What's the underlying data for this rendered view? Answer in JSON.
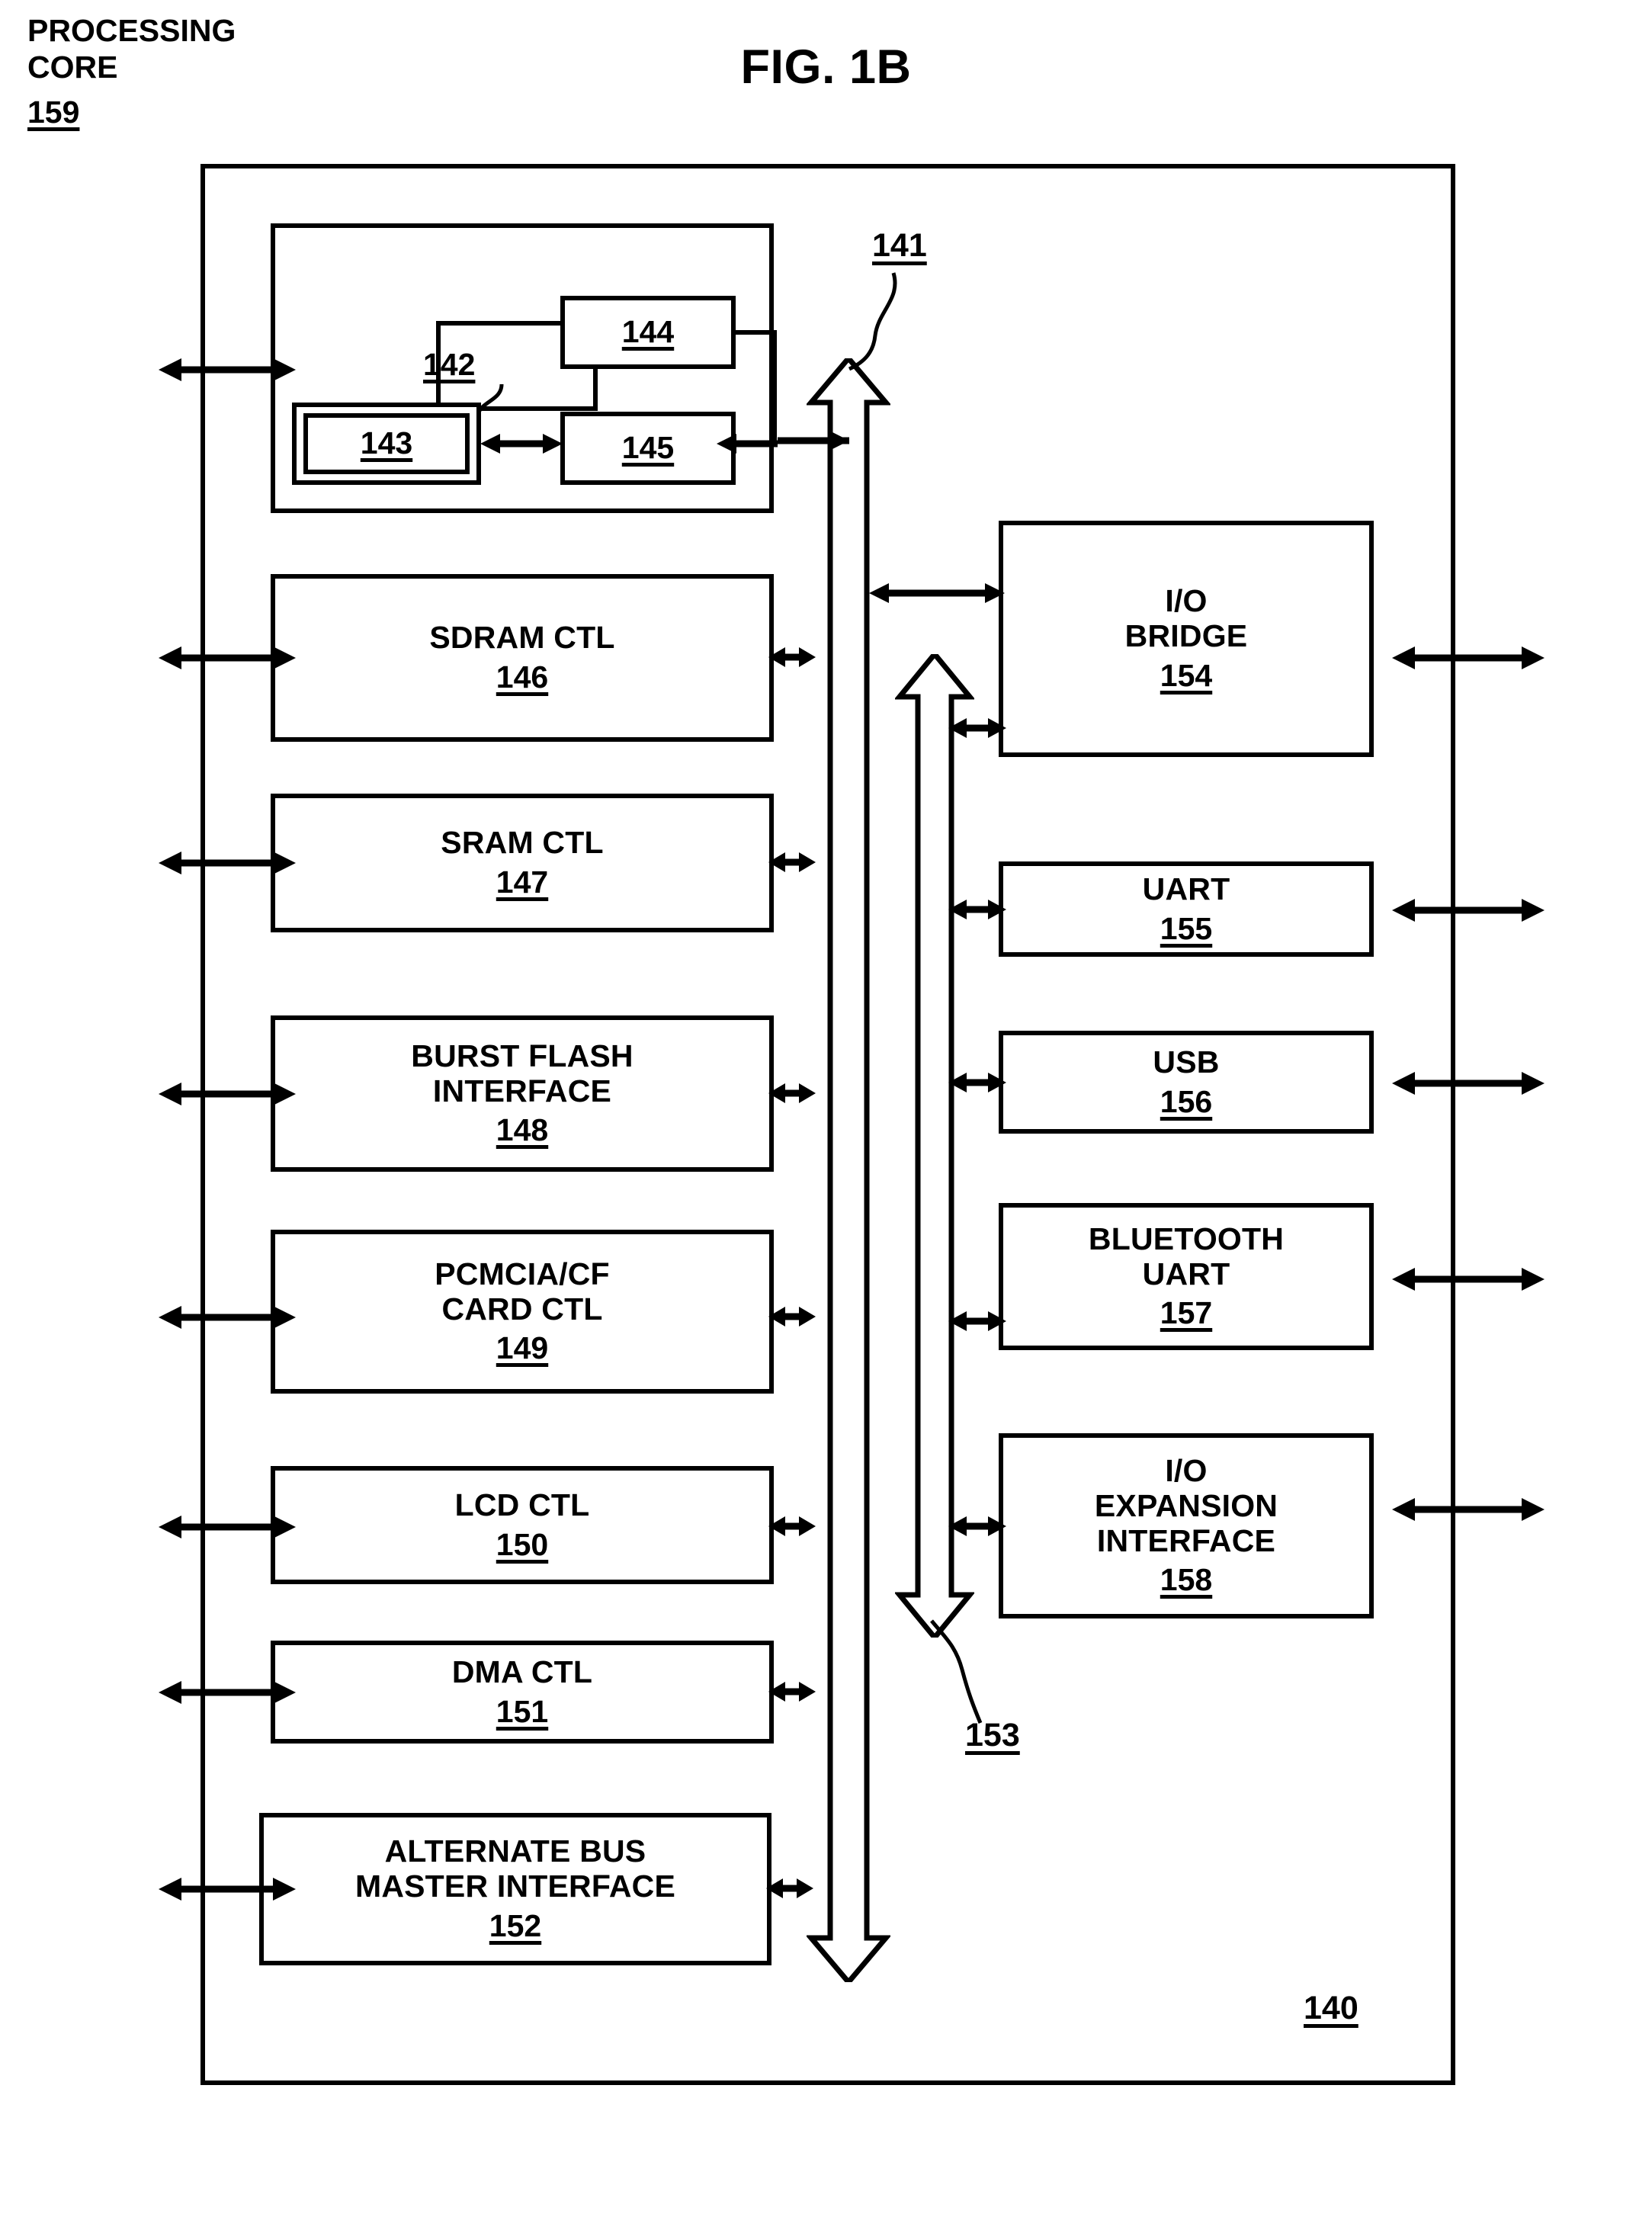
{
  "figure": {
    "title": "FIG. 1B",
    "chip_label": "140"
  },
  "processing_core": {
    "title": "PROCESSING\nCORE",
    "number": "159",
    "inner_blocks": [
      {
        "name": "block-142",
        "number": "142"
      },
      {
        "name": "block-143",
        "number": "143"
      },
      {
        "name": "block-144",
        "number": "144"
      },
      {
        "name": "block-145",
        "number": "145"
      }
    ]
  },
  "buses": [
    {
      "name": "main-bus",
      "number": "141"
    },
    {
      "name": "io-bus",
      "number": "153"
    }
  ],
  "left_column": [
    {
      "title": "SDRAM CTL",
      "number": "146"
    },
    {
      "title": "SRAM CTL",
      "number": "147"
    },
    {
      "title": "BURST FLASH\nINTERFACE",
      "number": "148"
    },
    {
      "title": "PCMCIA/CF\nCARD CTL",
      "number": "149"
    },
    {
      "title": "LCD CTL",
      "number": "150"
    },
    {
      "title": "DMA CTL",
      "number": "151"
    },
    {
      "title": "ALTERNATE BUS\nMASTER INTERFACE",
      "number": "152"
    }
  ],
  "right_column": [
    {
      "title": "I/O\nBRIDGE",
      "number": "154"
    },
    {
      "title": "UART",
      "number": "155"
    },
    {
      "title": "USB",
      "number": "156"
    },
    {
      "title": "BLUETOOTH\nUART",
      "number": "157"
    },
    {
      "title": "I/O\nEXPANSION\nINTERFACE",
      "number": "158"
    }
  ],
  "colors": {
    "ink": "#000000",
    "paper": "#ffffff"
  }
}
